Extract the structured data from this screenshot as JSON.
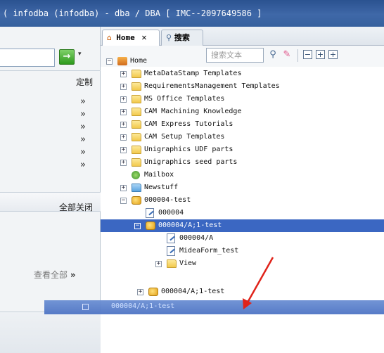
{
  "titlebar": {
    "text": "( infodba (infodba) - dba / DBA   [ IMC--2097649586 ]"
  },
  "left_panel": {
    "go_button": "→",
    "customize_label": "定制",
    "links": [
      "»",
      "»",
      "»",
      "»",
      "»",
      "»"
    ],
    "close_all_label": "全部关闭",
    "view_all_label": "查看全部",
    "view_all_chevron": "»"
  },
  "tabs": [
    {
      "label": "Home",
      "close": "✕"
    },
    {
      "label": "搜索"
    }
  ],
  "toolbar": {
    "search_placeholder": "搜索文本"
  },
  "tree": [
    {
      "label": "Home",
      "expander": "−",
      "icon": "home"
    },
    {
      "label": "MetaDataStamp Templates",
      "expander": "+",
      "icon": "folder"
    },
    {
      "label": "RequirementsManagement Templates",
      "expander": "+",
      "icon": "folder"
    },
    {
      "label": "MS Office Templates",
      "expander": "+",
      "icon": "folder"
    },
    {
      "label": "CAM Machining Knowledge",
      "expander": "+",
      "icon": "folder"
    },
    {
      "label": "CAM Express Tutorials",
      "expander": "+",
      "icon": "folder"
    },
    {
      "label": "CAM Setup Templates",
      "expander": "+",
      "icon": "folder"
    },
    {
      "label": "Unigraphics UDF parts",
      "expander": "+",
      "icon": "folder"
    },
    {
      "label": "Unigraphics seed parts",
      "expander": "+",
      "icon": "folder"
    },
    {
      "label": "Mailbox",
      "expander": "",
      "icon": "mail"
    },
    {
      "label": "Newstuff",
      "expander": "+",
      "icon": "folder"
    },
    {
      "label": "000004-test",
      "expander": "−",
      "icon": "item"
    },
    {
      "label": "000004",
      "expander": "",
      "icon": "doc"
    },
    {
      "label": "000004/A;1-test",
      "expander": "−",
      "icon": "item",
      "selected": true
    },
    {
      "label": "000004/A",
      "expander": "",
      "icon": "doc"
    },
    {
      "label": "MideaForm_test",
      "expander": "",
      "icon": "doc"
    },
    {
      "label": "View",
      "expander": "+",
      "icon": "folder"
    },
    {
      "label": "000004/A;1-test",
      "expander": "+",
      "icon": "item"
    }
  ],
  "drag_ghost": {
    "label": "000004/A;1-test"
  },
  "colors": {
    "selection": "#3b67c2",
    "titlebar": "#3f68a8",
    "arrow": "#e0231a"
  }
}
